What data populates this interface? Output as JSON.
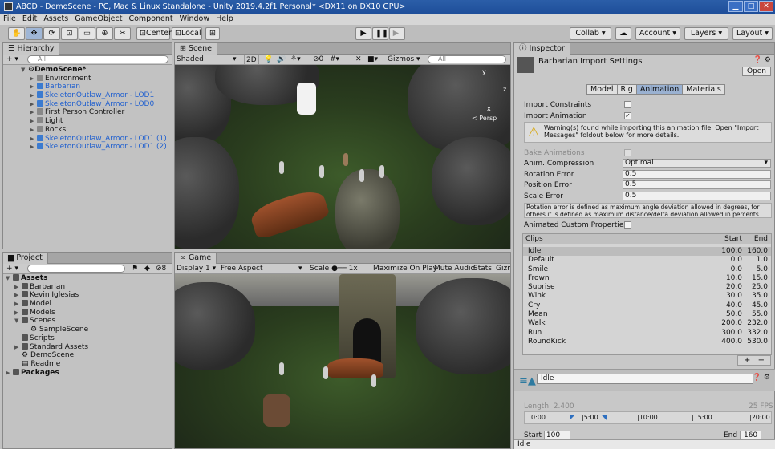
{
  "window": {
    "title": "ABCD - DemoScene - PC, Mac & Linux Standalone - Unity 2019.4.2f1 Personal* <DX11 on DX10 GPU>",
    "min": "▁",
    "max": "□",
    "close": "✕"
  },
  "menu": [
    "File",
    "Edit",
    "Assets",
    "GameObject",
    "Component",
    "Window",
    "Help"
  ],
  "toolbar": {
    "center": "Center",
    "local": "Local",
    "collab": "Collab ▾",
    "account": "Account",
    "layers": "Layers",
    "layout": "Layout"
  },
  "hierarchy": {
    "tab": "Hierarchy",
    "search": "All",
    "scene": "DemoScene*",
    "items": [
      "Environment",
      "Barbarian",
      "SkeletonOutlaw_Armor - LOD1",
      "SkeletonOutlaw_Armor - LOD0",
      "First Person Controller",
      "Light",
      "Rocks",
      "SkeletonOutlaw_Armor - LOD1 (1)",
      "SkeletonOutlaw_Armor - LOD1 (2)"
    ]
  },
  "scene": {
    "tab": "Scene",
    "shading": "Shaded",
    "mode2d": "2D",
    "fx_count": "0",
    "gizmos": "Gizmos",
    "search": "All",
    "persp": "< Persp",
    "axis_y": "y",
    "axis_x": "x",
    "axis_z": "z"
  },
  "project": {
    "tab": "Project",
    "count": "8",
    "root": "Assets",
    "items": [
      "Barbarian",
      "Kevin Iglesias",
      "Model",
      "Models",
      "Scenes",
      "SampleScene",
      "Scripts",
      "Standard Assets",
      "DemoScene",
      "Readme",
      "Packages"
    ]
  },
  "game": {
    "tab": "Game",
    "display": "Display 1",
    "aspect": "Free Aspect",
    "scale_label": "Scale",
    "scale_value": "1x",
    "maximize": "Maximize On Play",
    "mute": "Mute Audio",
    "stats": "Stats",
    "gizmos": "Gizmo"
  },
  "inspector": {
    "tab": "Inspector",
    "title": "Barbarian Import Settings",
    "open": "Open",
    "tabs": [
      "Model",
      "Rig",
      "Animation",
      "Materials"
    ],
    "import_constraints": "Import Constraints",
    "import_animation": "Import Animation",
    "warning": "Warning(s) found while importing this animation file. Open \"Import Messages\" foldout below for more details.",
    "bake": "Bake Animations",
    "anim_compression": "Anim. Compression",
    "compression_value": "Optimal",
    "rotation_error": "Rotation Error",
    "rotation_value": "0.5",
    "position_error": "Position Error",
    "position_value": "0.5",
    "scale_error": "Scale Error",
    "scale_value": "0.5",
    "info": "Rotation error is defined as maximum angle deviation allowed in degrees, for others it is defined as maximum distance/delta deviation allowed in percents",
    "custom_props": "Animated Custom Properties",
    "clips_header": {
      "name": "Clips",
      "start": "Start",
      "end": "End"
    },
    "clips": [
      {
        "name": "Idle",
        "start": "100.0",
        "end": "160.0"
      },
      {
        "name": "Default",
        "start": "0.0",
        "end": "1.0"
      },
      {
        "name": "Smile",
        "start": "0.0",
        "end": "5.0"
      },
      {
        "name": "Frown",
        "start": "10.0",
        "end": "15.0"
      },
      {
        "name": "Suprise",
        "start": "20.0",
        "end": "25.0"
      },
      {
        "name": "Wink",
        "start": "30.0",
        "end": "35.0"
      },
      {
        "name": "Cry",
        "start": "40.0",
        "end": "45.0"
      },
      {
        "name": "Mean",
        "start": "50.0",
        "end": "55.0"
      },
      {
        "name": "Walk",
        "start": "200.0",
        "end": "232.0"
      },
      {
        "name": "Run",
        "start": "300.0",
        "end": "332.0"
      },
      {
        "name": "RoundKick",
        "start": "400.0",
        "end": "530.0"
      }
    ],
    "add": "+",
    "remove": "−",
    "clip_name": "Idle",
    "length_label": "Length",
    "length_value": "2.400",
    "fps": "25 FPS",
    "timeline": [
      "0:00",
      "|5:00",
      "|10:00",
      "|15:00",
      "|20:00"
    ],
    "start_label": "Start",
    "start_value": "100",
    "end_label": "End",
    "end_value": "160",
    "preview_label": "Idle"
  }
}
